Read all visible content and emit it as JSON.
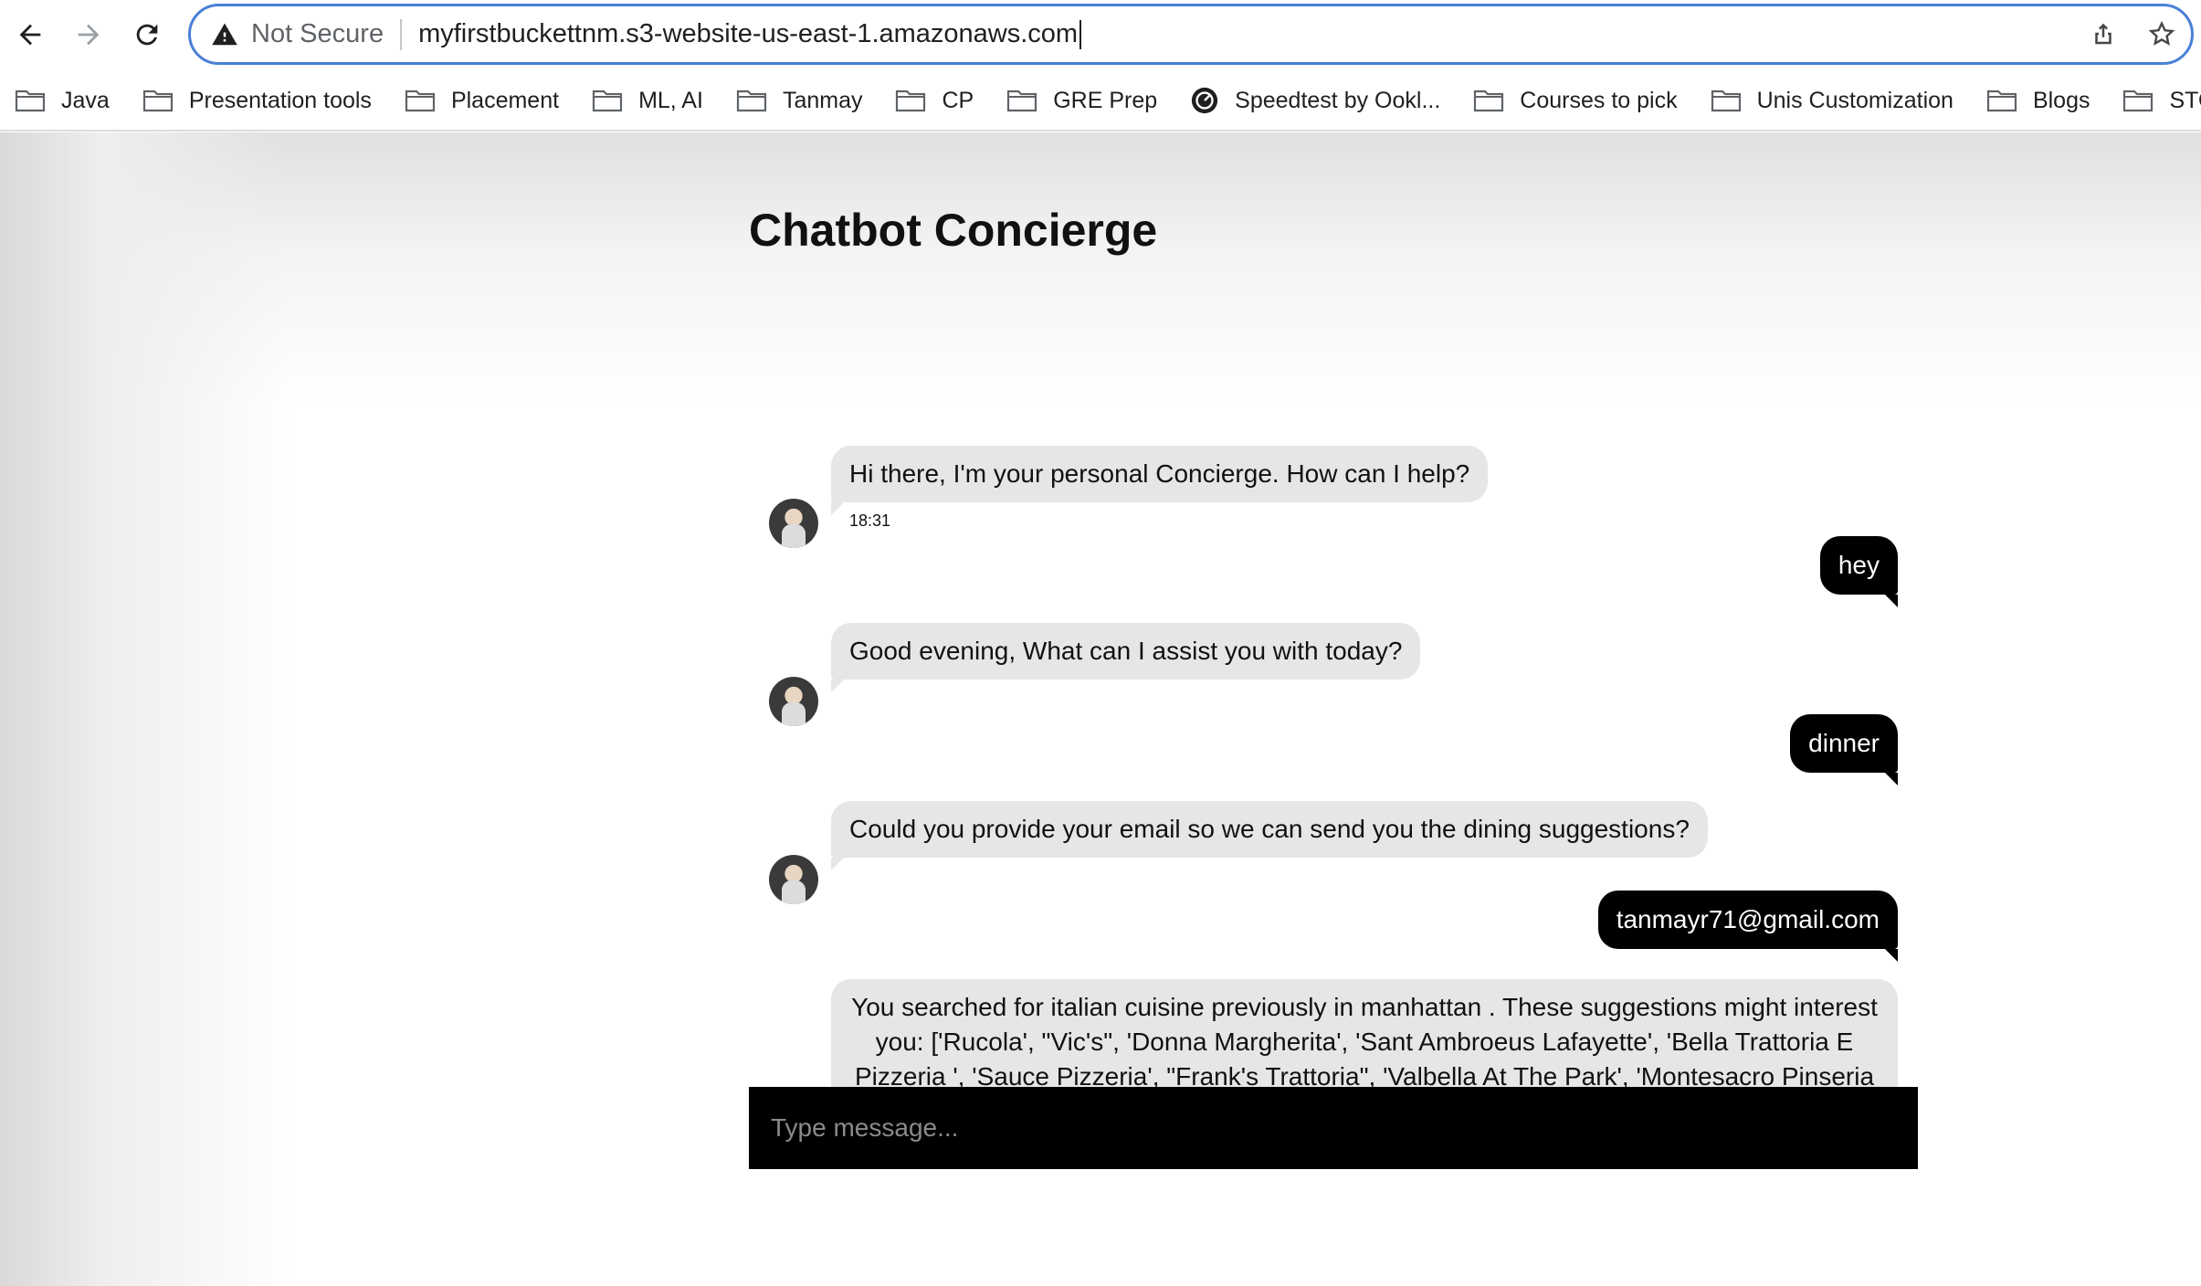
{
  "browser": {
    "security_label": "Not Secure",
    "url": "myfirstbuckettnm.s3-website-us-east-1.amazonaws.com",
    "icons": {
      "back": "back-arrow-icon",
      "forward": "forward-arrow-icon",
      "reload": "reload-icon",
      "warning": "warning-triangle-icon",
      "share": "share-icon",
      "bookmark": "star-icon"
    }
  },
  "bookmarks": [
    {
      "label": "Java",
      "icon": "folder-icon"
    },
    {
      "label": "Presentation tools",
      "icon": "folder-icon"
    },
    {
      "label": "Placement",
      "icon": "folder-icon"
    },
    {
      "label": "ML, AI",
      "icon": "folder-icon"
    },
    {
      "label": "Tanmay",
      "icon": "folder-icon"
    },
    {
      "label": "CP",
      "icon": "folder-icon"
    },
    {
      "label": "GRE Prep",
      "icon": "folder-icon"
    },
    {
      "label": "Speedtest by Ookl...",
      "icon": "speedtest-icon"
    },
    {
      "label": "Courses to pick",
      "icon": "folder-icon"
    },
    {
      "label": "Unis Customization",
      "icon": "folder-icon"
    },
    {
      "label": "Blogs",
      "icon": "folder-icon"
    },
    {
      "label": "STONK",
      "icon": "folder-icon"
    }
  ],
  "page": {
    "title": "Chatbot Concierge"
  },
  "chat": {
    "messages": [
      {
        "sender": "bot",
        "text": "Hi there, I'm your personal Concierge. How can I help?",
        "time": "18:31"
      },
      {
        "sender": "user",
        "text": "hey"
      },
      {
        "sender": "bot",
        "text": "Good evening, What can I assist you with today?"
      },
      {
        "sender": "user",
        "text": "dinner"
      },
      {
        "sender": "bot",
        "text": "Could you provide your email so we can send you the dining suggestions?"
      },
      {
        "sender": "user",
        "text": "tanmayr71@gmail.com"
      },
      {
        "sender": "bot",
        "text": "You searched for italian cuisine previously in manhattan . These suggestions might interest you: ['Rucola', \"Vic's\", 'Donna Margherita', 'Sant Ambroeus Lafayette', 'Bella Trattoria E Pizzeria ', 'Sauce Pizzeria', \"Frank's Trattoria\", 'Valbella At The Park', 'Montesacro Pinseria"
      }
    ],
    "input_placeholder": "Type message..."
  },
  "colors": {
    "accent_focus": "#4a7fd6",
    "user_bubble": "#000000",
    "bot_bubble": "#e6e6e6",
    "input_bar": "#000000"
  }
}
